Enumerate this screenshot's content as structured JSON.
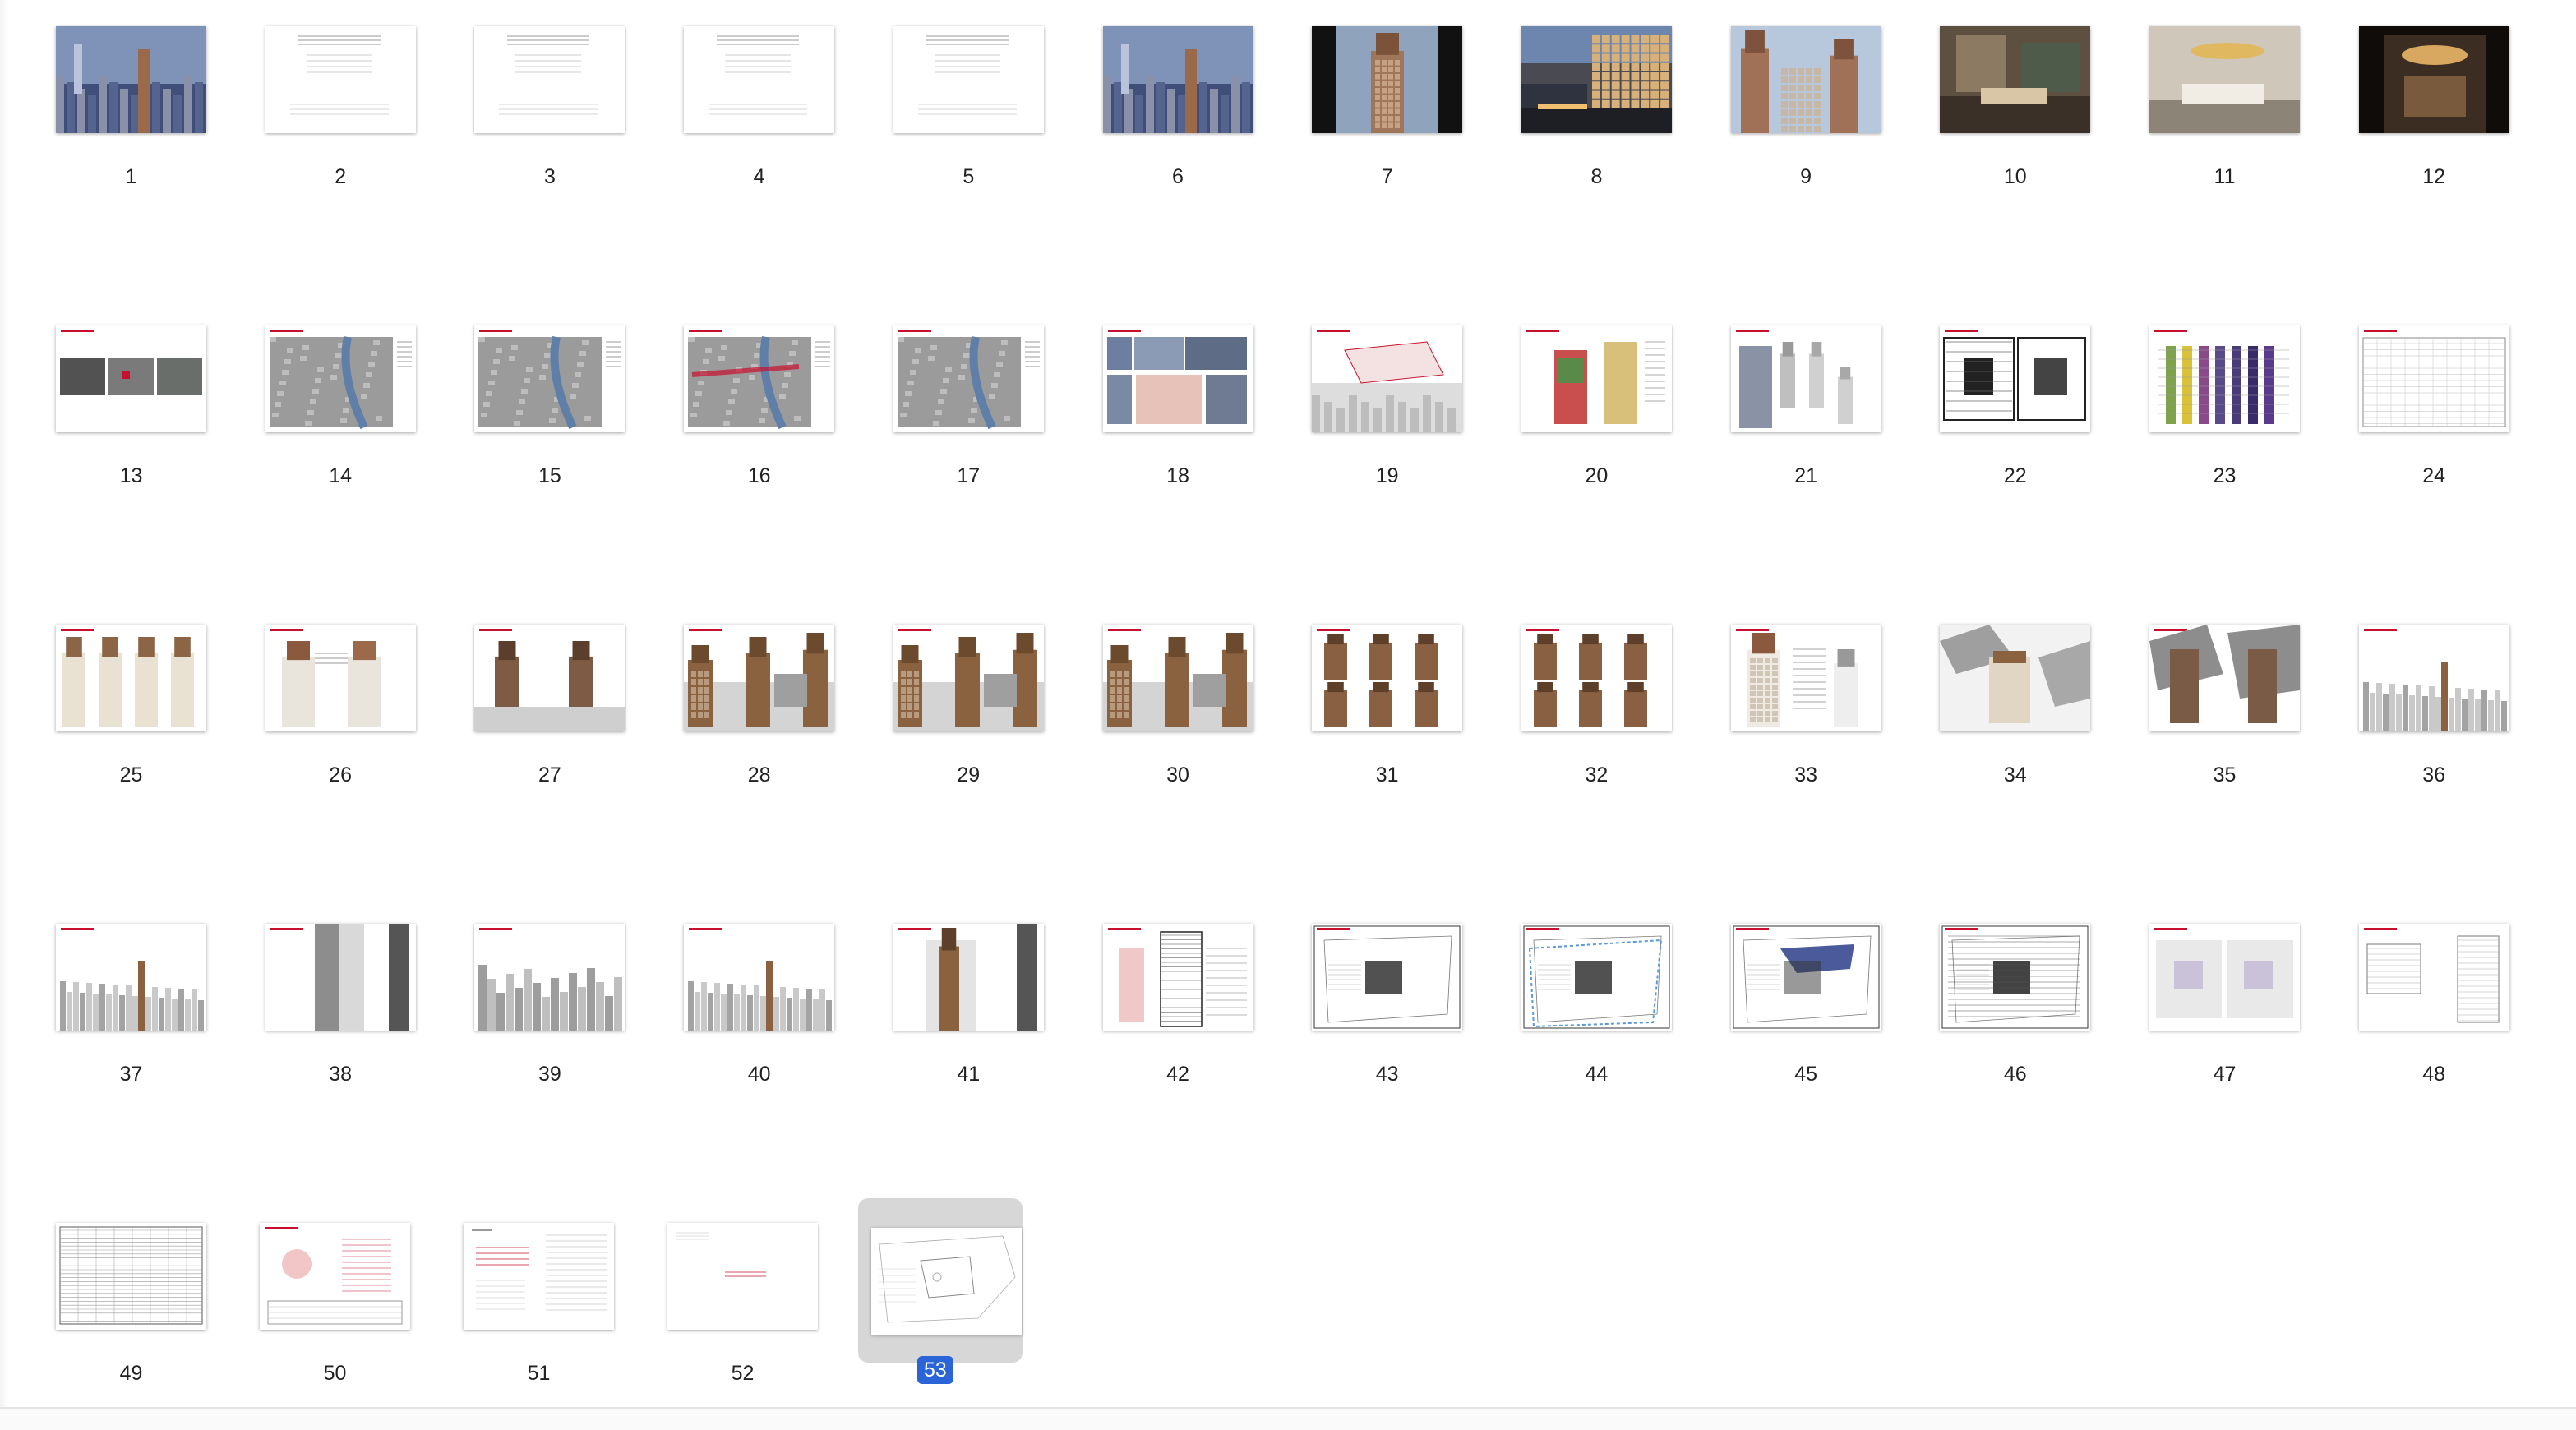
{
  "app": {
    "view": "Contact Sheet",
    "selected_page": "53",
    "colors": {
      "selection_badge": "#2a64d6",
      "selection_bg": "#d7d7d7",
      "accent_red": "#c8102e"
    }
  },
  "pages": [
    {
      "label": "1",
      "kind": "photo-city"
    },
    {
      "label": "2",
      "kind": "text-doc"
    },
    {
      "label": "3",
      "kind": "text-doc"
    },
    {
      "label": "4",
      "kind": "text-doc"
    },
    {
      "label": "5",
      "kind": "text-doc"
    },
    {
      "label": "6",
      "kind": "photo-city"
    },
    {
      "label": "7",
      "kind": "photo-tower-dark"
    },
    {
      "label": "8",
      "kind": "photo-street"
    },
    {
      "label": "9",
      "kind": "photo-towers"
    },
    {
      "label": "10",
      "kind": "photo-interior"
    },
    {
      "label": "11",
      "kind": "photo-interior-light"
    },
    {
      "label": "12",
      "kind": "photo-interior-dark"
    },
    {
      "label": "13",
      "kind": "aerial-strip"
    },
    {
      "label": "14",
      "kind": "aerial-map"
    },
    {
      "label": "15",
      "kind": "aerial-map"
    },
    {
      "label": "16",
      "kind": "aerial-map-red"
    },
    {
      "label": "17",
      "kind": "aerial-map"
    },
    {
      "label": "18",
      "kind": "collage"
    },
    {
      "label": "19",
      "kind": "site-diagram"
    },
    {
      "label": "20",
      "kind": "tower-diagram-color"
    },
    {
      "label": "21",
      "kind": "tower-variants"
    },
    {
      "label": "22",
      "kind": "floor-plans"
    },
    {
      "label": "23",
      "kind": "section-bars"
    },
    {
      "label": "24",
      "kind": "table"
    },
    {
      "label": "25",
      "kind": "tower-light-row"
    },
    {
      "label": "26",
      "kind": "tower-pair-light"
    },
    {
      "label": "27",
      "kind": "tower-pair-dark"
    },
    {
      "label": "28",
      "kind": "tower-massing"
    },
    {
      "label": "29",
      "kind": "tower-massing"
    },
    {
      "label": "30",
      "kind": "tower-massing"
    },
    {
      "label": "31",
      "kind": "tower-grid"
    },
    {
      "label": "32",
      "kind": "tower-grid"
    },
    {
      "label": "33",
      "kind": "tower-elevation"
    },
    {
      "label": "34",
      "kind": "tower-aerial"
    },
    {
      "label": "35",
      "kind": "tower-aerial-pair"
    },
    {
      "label": "36",
      "kind": "skyline"
    },
    {
      "label": "37",
      "kind": "skyline"
    },
    {
      "label": "38",
      "kind": "tower-closeup"
    },
    {
      "label": "39",
      "kind": "skyline-block"
    },
    {
      "label": "40",
      "kind": "skyline"
    },
    {
      "label": "41",
      "kind": "tower-closeup-brown"
    },
    {
      "label": "42",
      "kind": "section-drawing"
    },
    {
      "label": "43",
      "kind": "site-plan"
    },
    {
      "label": "44",
      "kind": "site-plan-blue"
    },
    {
      "label": "45",
      "kind": "site-plan-outline"
    },
    {
      "label": "46",
      "kind": "site-plan-dense"
    },
    {
      "label": "47",
      "kind": "plan-pair-faint"
    },
    {
      "label": "48",
      "kind": "form-table"
    },
    {
      "label": "49",
      "kind": "table-dense"
    },
    {
      "label": "50",
      "kind": "sketch-form"
    },
    {
      "label": "51",
      "kind": "text-doc-red"
    },
    {
      "label": "52",
      "kind": "text-doc-sparse"
    },
    {
      "label": "53",
      "kind": "site-plan-faint"
    }
  ]
}
